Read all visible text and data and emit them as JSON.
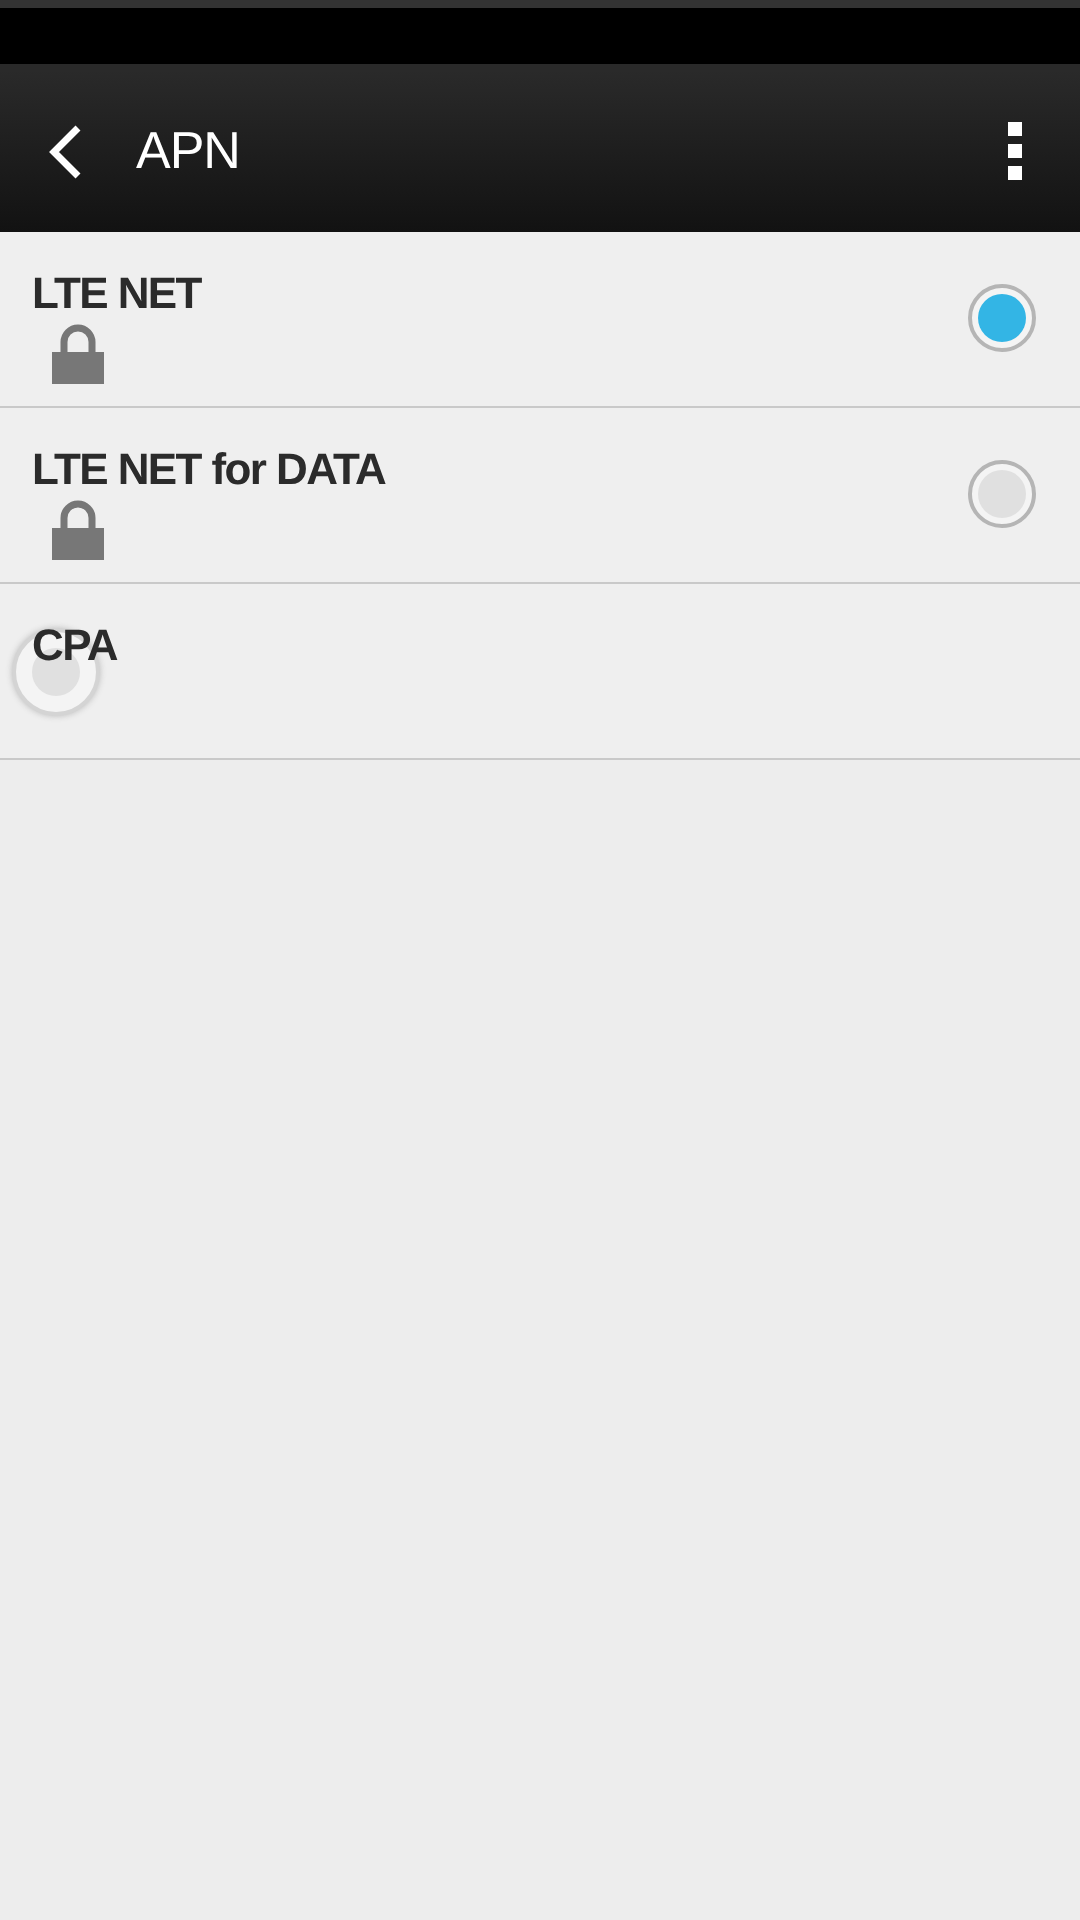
{
  "toolbar": {
    "title": "APN"
  },
  "apns": [
    {
      "name": "LTE NET",
      "locked": true,
      "selected": true,
      "kind": "right"
    },
    {
      "name": "LTE NET for DATA",
      "locked": true,
      "selected": false,
      "kind": "right"
    },
    {
      "name": "CPA",
      "locked": false,
      "selected": false,
      "kind": "left"
    }
  ]
}
